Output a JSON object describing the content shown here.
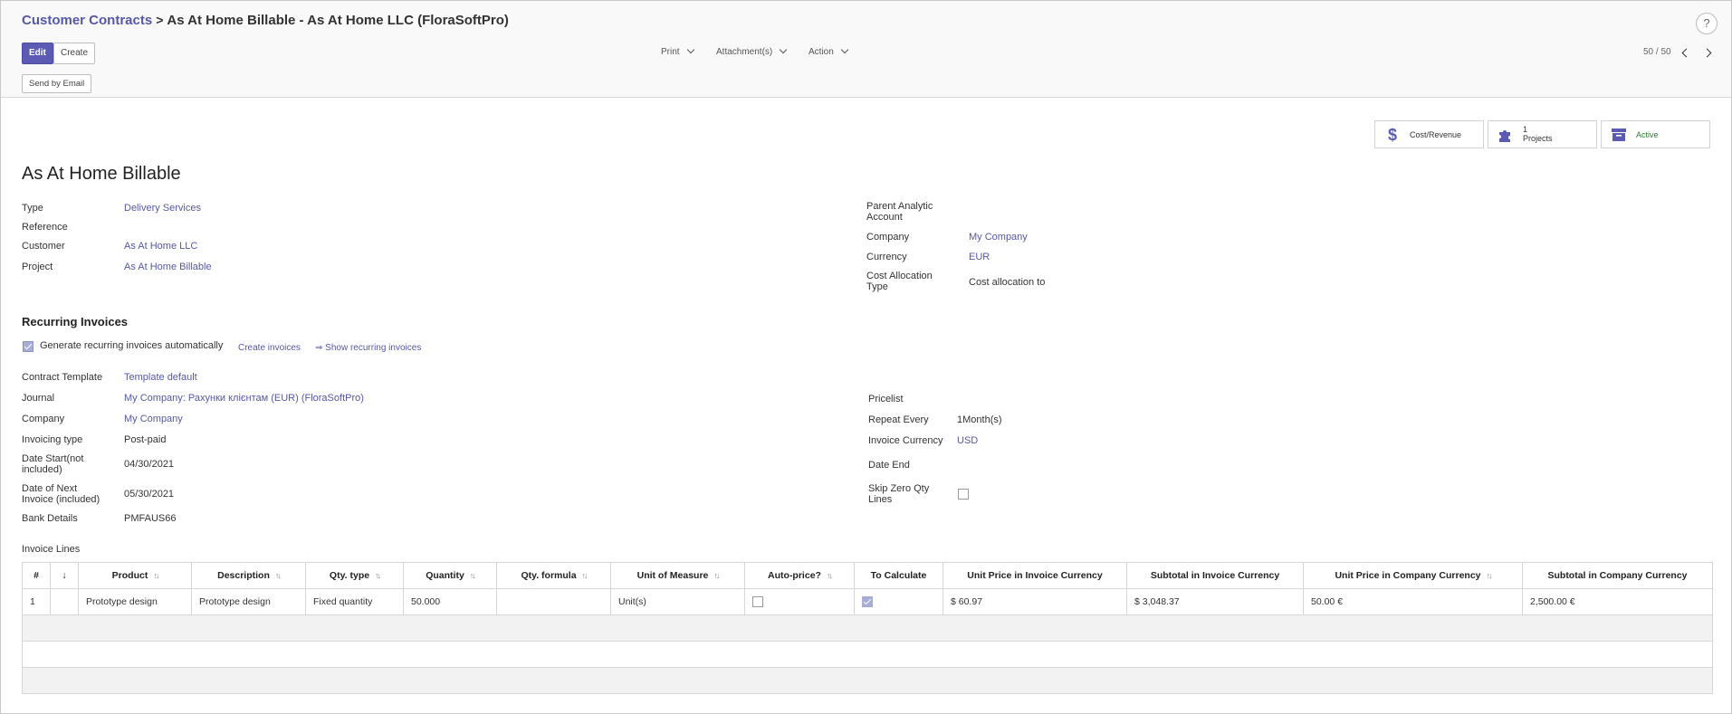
{
  "breadcrumb": {
    "parent": "Customer Contracts",
    "separator": ">",
    "current": "As At Home Billable - As At Home LLC (FloraSoftPro)"
  },
  "help_label": "?",
  "toolbar": {
    "edit_label": "Edit",
    "create_label": "Create",
    "print_label": "Print",
    "attachments_label": "Attachment(s)",
    "action_label": "Action",
    "send_email_label": "Send by Email"
  },
  "pager": {
    "value": "50 / 50"
  },
  "smart_buttons": {
    "cost_revenue": {
      "icon": "dollar-icon",
      "label": "Cost/Revenue"
    },
    "projects": {
      "icon": "puzzle-icon",
      "count": "1",
      "label": "Projects"
    },
    "active": {
      "icon": "archive-icon",
      "label": "Active"
    }
  },
  "record": {
    "title": "As At Home Billable",
    "left_fields": [
      {
        "label": "Type",
        "value": "Delivery Services"
      },
      {
        "label": "Reference",
        "value": ""
      },
      {
        "label": "Customer",
        "value": "As At Home LLC"
      },
      {
        "label": "Project",
        "value": "As At Home Billable"
      }
    ],
    "right_fields": [
      {
        "label": "Parent Analytic Account",
        "value": ""
      },
      {
        "label": "Company",
        "value": "My Company"
      },
      {
        "label": "Currency",
        "value": "EUR"
      },
      {
        "label": "Cost Allocation Type",
        "value": "Cost allocation to"
      }
    ]
  },
  "recurring": {
    "section_title": "Recurring Invoices",
    "auto_generate": {
      "label": "Generate recurring invoices automatically",
      "checked": true
    },
    "create_invoices_label": "Create invoices",
    "show_recurring_label": "⇒ Show recurring invoices",
    "left_fields": [
      {
        "label": "Contract Template",
        "value": "Template default"
      },
      {
        "label": "Journal",
        "value": "My Company: Рахунки клієнтам (EUR) (FloraSoftPro)"
      },
      {
        "label": "Company",
        "value": "My Company"
      },
      {
        "label": "Invoicing type",
        "value": "Post-paid"
      },
      {
        "label": "Date Start(not included)",
        "value": "04/30/2021"
      },
      {
        "label": "Date of Next Invoice (included)",
        "value": "05/30/2021"
      },
      {
        "label": "Bank Details",
        "value": "PMFAUS66"
      }
    ],
    "right_fields": [
      {
        "label": "Pricelist",
        "value": ""
      },
      {
        "label": "Repeat Every",
        "value": "1Month(s)"
      },
      {
        "label": "Invoice Currency",
        "value": "USD"
      },
      {
        "label": "Date End",
        "value": ""
      },
      {
        "label": "Skip Zero Qty Lines",
        "value": "",
        "checked": false
      }
    ]
  },
  "invoice_lines": {
    "title": "Invoice Lines",
    "columns": [
      "#",
      "↓",
      "Product",
      "Description",
      "Qty. type",
      "Quantity",
      "Qty. formula",
      "Unit of Measure",
      "Auto-price?",
      "To Calculate",
      "Unit Price in Invoice Currency",
      "Subtotal in Invoice Currency",
      "Unit Price in Company Currency",
      "Subtotal in Company Currency"
    ],
    "rows": [
      {
        "num": "1",
        "handle": "",
        "product": "Prototype design",
        "description": "Prototype design",
        "qty_type": "Fixed quantity",
        "quantity": "50.000",
        "qty_formula": "",
        "uom": "Unit(s)",
        "auto_price": false,
        "to_calculate": true,
        "unit_price_invoice": "$ 60.97",
        "subtotal_invoice": "$ 3,048.37",
        "unit_price_company": "50.00 €",
        "subtotal_company": "2,500.00 €"
      }
    ]
  }
}
